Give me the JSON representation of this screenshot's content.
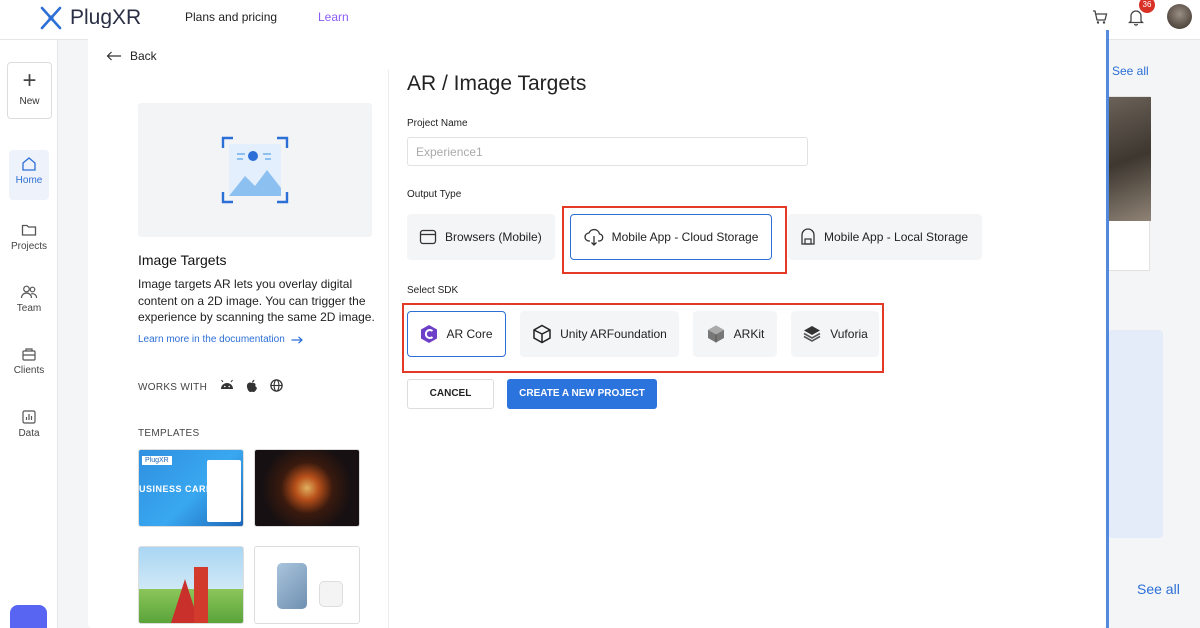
{
  "app": {
    "logo_text": "PlugXR",
    "nav": {
      "plans": "Plans and pricing",
      "learn": "Learn"
    },
    "notifications_count": "36"
  },
  "sidebar": {
    "new_label": "New",
    "items": [
      {
        "label": "Home"
      },
      {
        "label": "Projects"
      },
      {
        "label": "Team"
      },
      {
        "label": "Clients"
      },
      {
        "label": "Data"
      }
    ]
  },
  "background": {
    "see_all_1": "See all",
    "see_all_2": "See all"
  },
  "modal": {
    "back_label": "Back",
    "left": {
      "title": "Image Targets",
      "description": "Image targets AR lets you overlay digital content on a 2D image. You can trigger the experience by scanning the same 2D image.",
      "doc_link": "Learn more in the documentation",
      "works_with_label": "WORKS WITH",
      "templates_label": "TEMPLATES",
      "templates": [
        {
          "tag": "PlugXR",
          "text": "USINESS CARD"
        },
        {
          "tag": ""
        },
        {
          "tag": ""
        },
        {
          "tag": ""
        }
      ]
    },
    "form": {
      "title": "AR / Image Targets",
      "project_name_label": "Project Name",
      "project_name_placeholder": "Experience1",
      "output_type_label": "Output Type",
      "output_options": [
        {
          "label": "Browsers (Mobile)",
          "selected": false
        },
        {
          "label": "Mobile App - Cloud Storage",
          "selected": true
        },
        {
          "label": "Mobile App - Local Storage",
          "selected": false
        }
      ],
      "sdk_label": "Select SDK",
      "sdk_options": [
        {
          "label": "AR Core",
          "selected": true
        },
        {
          "label": "Unity ARFoundation",
          "selected": false
        },
        {
          "label": "ARKit",
          "selected": false
        },
        {
          "label": "Vuforia",
          "selected": false
        }
      ],
      "cancel_label": "CANCEL",
      "create_label": "CREATE A NEW PROJECT"
    }
  },
  "colors": {
    "accent": "#2c74dd",
    "highlight": "#e23a26",
    "learn": "#8a5cf6"
  }
}
